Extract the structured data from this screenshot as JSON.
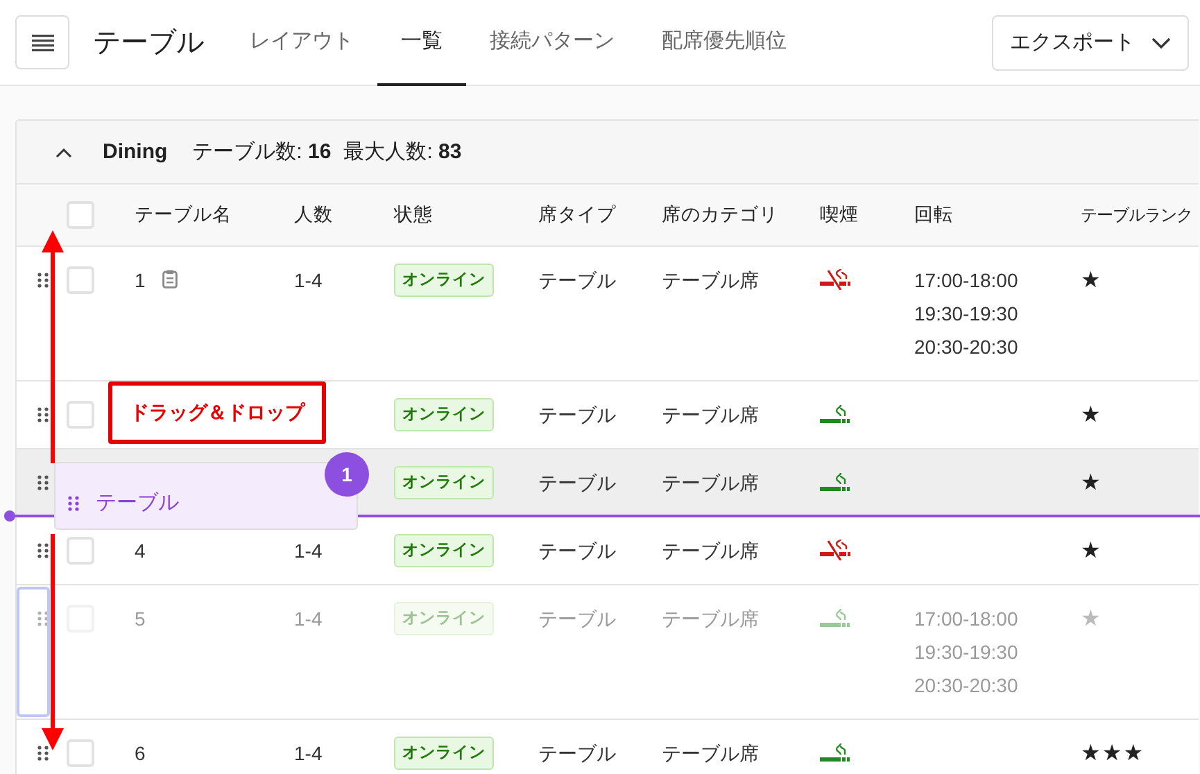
{
  "page_title": "テーブル",
  "tabs": [
    {
      "label": "レイアウト",
      "selected": false
    },
    {
      "label": "一覧",
      "selected": true
    },
    {
      "label": "接続パターン",
      "selected": false
    },
    {
      "label": "配席優先順位",
      "selected": false
    }
  ],
  "export_button": {
    "label": "エクスポート"
  },
  "group": {
    "name": "Dining",
    "expanded": true,
    "stats": [
      "テーブル数: **16**",
      "最大人数: **83**"
    ]
  },
  "header_checkbox": {
    "checked": false
  },
  "columns": [
    "テーブル名",
    "人数",
    "状態",
    "席タイプ",
    "席のカテゴリ",
    "喫煙",
    "回転",
    "テーブルランク"
  ],
  "rows": [
    {
      "name": "1",
      "memo": true,
      "people": "1-4",
      "status": "オンライン",
      "seat_type": "テーブル",
      "category": "テーブル席",
      "smoking": false,
      "rotations": [
        "17:00-18:00",
        "19:30-19:30",
        "20:30-20:30"
      ],
      "rank": "★",
      "checked": false,
      "highlighted": false,
      "dragging": false
    },
    {
      "status": "オンライン",
      "seat_type": "テーブル",
      "category": "テーブル席",
      "smoking": true,
      "rank": "★",
      "checked": false,
      "highlighted": false,
      "dragging": false
    },
    {
      "status": "オンライン",
      "seat_type": "テーブル",
      "category": "テーブル席",
      "smoking": true,
      "rank": "★",
      "highlighted": true,
      "dragging": false
    },
    {
      "name": "4",
      "memo": false,
      "people": "1-4",
      "status": "オンライン",
      "seat_type": "テーブル",
      "category": "テーブル席",
      "smoking": false,
      "rank": "★",
      "checked": false,
      "highlighted": false,
      "dragging": false
    },
    {
      "name": "5",
      "memo": false,
      "people": "1-4",
      "status": "オンライン",
      "seat_type": "テーブル",
      "category": "テーブル席",
      "smoking": true,
      "rotations": [
        "17:00-18:00",
        "19:30-19:30",
        "20:30-20:30"
      ],
      "rank": "★",
      "checked": false,
      "highlighted": false,
      "dragging": true
    },
    {
      "name": "6",
      "memo": false,
      "people": "1-4",
      "status": "オンライン",
      "seat_type": "テーブル",
      "category": "テーブル席",
      "smoking": true,
      "rank": "★★★",
      "checked": false,
      "highlighted": false,
      "dragging": false
    }
  ],
  "annotation": {
    "label": "ドラッグ＆ドロップ"
  },
  "drag_ghost": {
    "label": "テーブル",
    "count": "1"
  }
}
